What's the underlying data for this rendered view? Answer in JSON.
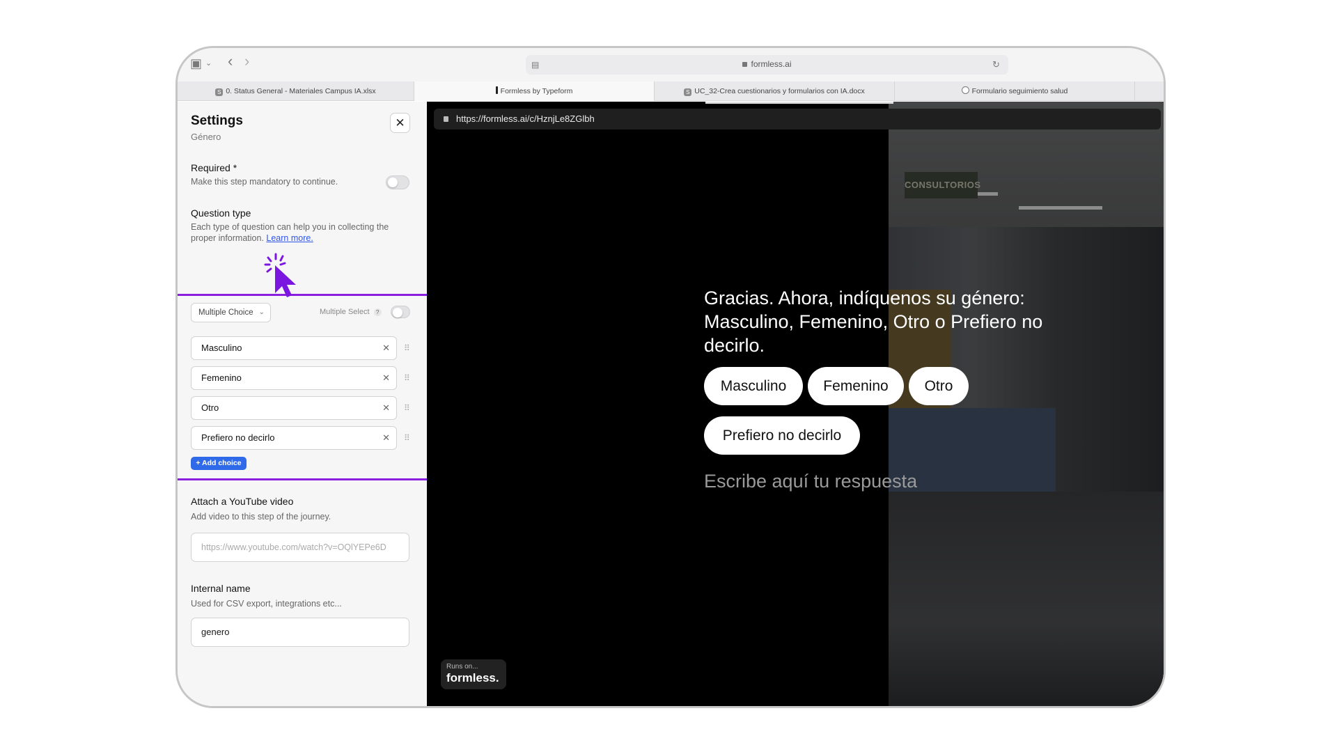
{
  "browser": {
    "address": "formless.ai",
    "tabs": [
      {
        "label": "0. Status General - Materiales Campus IA.xlsx",
        "favicon": "S"
      },
      {
        "label": "Formless by Typeform",
        "favicon": ""
      },
      {
        "label": "UC_32-Crea cuestionarios y formularios con IA.docx",
        "favicon": "S"
      },
      {
        "label": "Formulario seguimiento salud",
        "favicon": ""
      }
    ]
  },
  "settings": {
    "title": "Settings",
    "subtitle": "Género",
    "required_label": "Required *",
    "required_help": "Make this step mandatory to continue.",
    "question_type_label": "Question type",
    "question_type_help": "Each type of question can help you in collecting the proper information.",
    "learn_more": "Learn more.",
    "select_value": "Multiple Choice",
    "multiple_select_label": "Multiple Select",
    "help_badge": "?",
    "choices": [
      "Masculino",
      "Femenino",
      "Otro",
      "Prefiero no decirlo"
    ],
    "add_choice": "+ Add choice",
    "youtube_label": "Attach a YouTube video",
    "youtube_help": "Add video to this step of the journey.",
    "youtube_placeholder": "https://www.youtube.com/watch?v=OQlYEPe6D",
    "internal_label": "Internal name",
    "internal_help": "Used for CSV export, integrations etc...",
    "internal_value": "genero"
  },
  "preview": {
    "url": "https://formless.ai/c/HznjLe8ZGlbh",
    "question": "Gracias. Ahora, indíquenos su género: Masculino, Femenino, Otro o Prefiero no decirlo.",
    "options": [
      "Masculino",
      "Femenino",
      "Otro",
      "Prefiero no decirlo"
    ],
    "answer_placeholder": "Escribe aquí tu respuesta",
    "sign_text": "CONSULTORIOS",
    "runs_on_small": "Runs on...",
    "runs_on_brand": "formless."
  },
  "colors": {
    "highlight": "#8b1fe0",
    "accent": "#2f6be8",
    "cursor": "#7b16e0"
  }
}
